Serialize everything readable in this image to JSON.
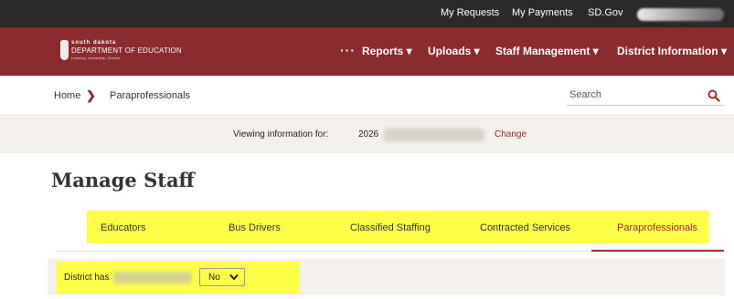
{
  "topbar": {
    "links": [
      "My Requests",
      "My Payments",
      "SD.Gov"
    ]
  },
  "logo": {
    "line1": "south dakota",
    "line2": "DEPARTMENT OF EDUCATION",
    "line3": "Learning. Leadership. Service."
  },
  "nav": {
    "more": "···",
    "items": [
      "Reports ▾",
      "Uploads ▾",
      "Staff Management ▾",
      "District Information ▾"
    ]
  },
  "breadcrumb": {
    "home": "Home",
    "separator": "❯",
    "current": "Paraprofessionals"
  },
  "search": {
    "placeholder": "Search",
    "icon": "search-icon"
  },
  "viewing": {
    "label": "Viewing information for:",
    "year": "2026",
    "change": "Change"
  },
  "page": {
    "title": "Manage Staff"
  },
  "tabs": [
    "Educators",
    "Bus Drivers",
    "Classified Staffing",
    "Contracted Services",
    "Paraprofessionals"
  ],
  "active_tab": "Paraprofessionals",
  "district": {
    "label": "District has",
    "select_value": "No"
  },
  "colors": {
    "brand": "#8a2b2e",
    "topbar": "#2a2a2a",
    "highlight": "#ffff4a",
    "active_tab": "#a32a2e",
    "panel": "#f4f1ec"
  }
}
